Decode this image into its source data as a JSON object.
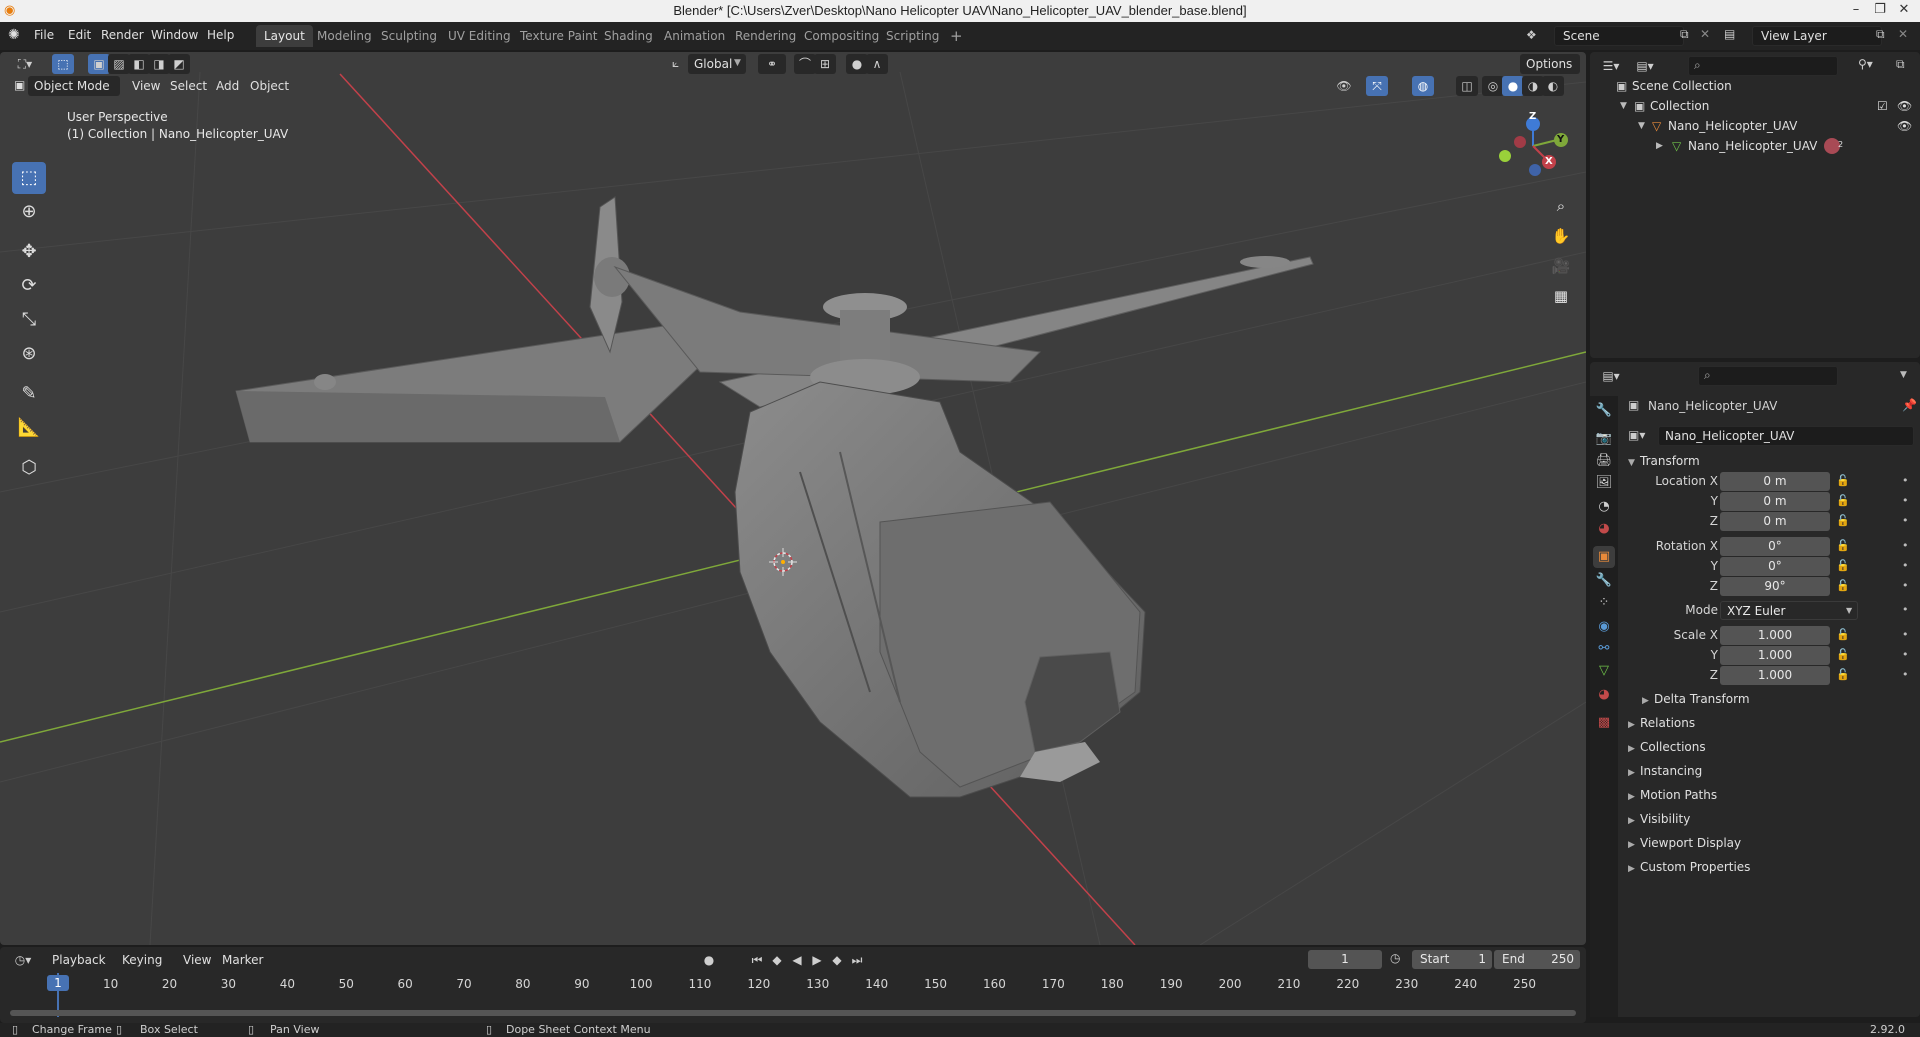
{
  "window": {
    "title": "Blender* [C:\\Users\\Zver\\Desktop\\Nano Helicopter UAV\\Nano_Helicopter_UAV_blender_base.blend]",
    "controls": [
      "–",
      "❐",
      "✕"
    ]
  },
  "menu": [
    "File",
    "Edit",
    "Render",
    "Window",
    "Help"
  ],
  "workspaces": [
    {
      "label": "Layout",
      "active": true
    },
    {
      "label": "Modeling"
    },
    {
      "label": "Sculpting"
    },
    {
      "label": "UV Editing"
    },
    {
      "label": "Texture Paint"
    },
    {
      "label": "Shading"
    },
    {
      "label": "Animation"
    },
    {
      "label": "Rendering"
    },
    {
      "label": "Compositing"
    },
    {
      "label": "Scripting"
    }
  ],
  "workspace_add": "+",
  "scene": {
    "label": "Scene"
  },
  "view_layer": {
    "label": "View Layer"
  },
  "viewport": {
    "orientation": "Global",
    "options_label": "Options",
    "mode": "Object Mode",
    "header_menu": [
      "View",
      "Select",
      "Add",
      "Object"
    ],
    "overlay_text_1": "User Perspective",
    "overlay_text_2": "(1) Collection | Nano_Helicopter_UAV",
    "gizmo": {
      "x": "X",
      "y": "Y",
      "z": "Z"
    }
  },
  "outliner": {
    "rows": [
      {
        "label": "Scene Collection"
      },
      {
        "label": "Collection"
      },
      {
        "label": "Nano_Helicopter_UAV"
      },
      {
        "label": "Nano_Helicopter_UAV",
        "badge": "2"
      }
    ]
  },
  "properties": {
    "object_name": "Nano_Helicopter_UAV",
    "datablock_name": "Nano_Helicopter_UAV",
    "transform_label": "Transform",
    "location": {
      "label_x": "Location X",
      "label_y": "Y",
      "label_z": "Z",
      "x": "0 m",
      "y": "0 m",
      "z": "0 m"
    },
    "rotation": {
      "label_x": "Rotation X",
      "label_y": "Y",
      "label_z": "Z",
      "x": "0°",
      "y": "0°",
      "z": "90°"
    },
    "mode_label": "Mode",
    "mode_value": "XYZ Euler",
    "scale": {
      "label_x": "Scale X",
      "label_y": "Y",
      "label_z": "Z",
      "x": "1.000",
      "y": "1.000",
      "z": "1.000"
    },
    "delta_transform": "Delta Transform",
    "sections": [
      "Relations",
      "Collections",
      "Instancing",
      "Motion Paths",
      "Visibility",
      "Viewport Display",
      "Custom Properties"
    ]
  },
  "timeline": {
    "menu": [
      "Playback",
      "Keying",
      "View",
      "Marker"
    ],
    "current_frame": "1",
    "start_label": "Start",
    "start_value": "1",
    "end_label": "End",
    "end_value": "250",
    "ruler": [
      "1",
      "10",
      "20",
      "30",
      "40",
      "50",
      "60",
      "70",
      "80",
      "90",
      "100",
      "110",
      "120",
      "130",
      "140",
      "150",
      "160",
      "170",
      "180",
      "190",
      "200",
      "210",
      "220",
      "230",
      "240",
      "250"
    ]
  },
  "status": {
    "items": [
      "Change Frame",
      "Box Select",
      "Pan View",
      "Dope Sheet Context Menu"
    ],
    "version": "2.92.0"
  },
  "colors": {
    "accent": "#4772b3",
    "x_axis": "#c2414a",
    "y_axis": "#7fa83a",
    "object_orange": "#e88a3a"
  }
}
